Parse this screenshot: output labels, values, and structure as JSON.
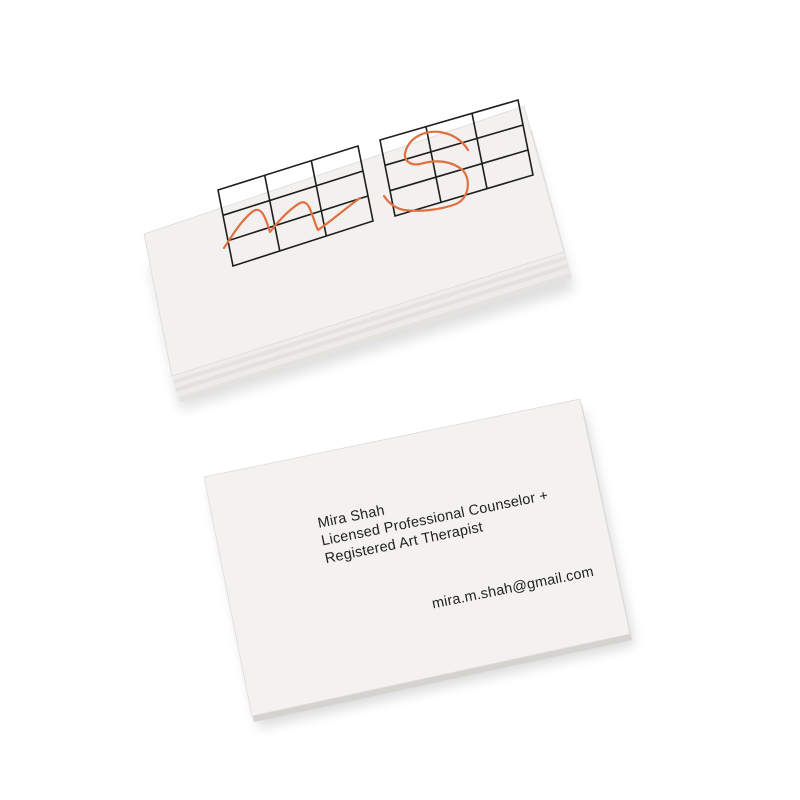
{
  "front_card": {
    "name": "Mira Shah",
    "title_line1": "Licensed Professional Counselor +",
    "title_line2": "Registered Art Therapist",
    "email": "mira.m.shah@gmail.com"
  },
  "back_card": {
    "logo": {
      "letters": "MS",
      "grid": "3x3 grid per letter, two grids",
      "stroke_color": "#e0703f",
      "grid_color": "#1e1e1e"
    }
  },
  "colors": {
    "background": "#ffffff",
    "card": "#f1f0ee",
    "card_edge": "#d9d8d5",
    "text": "#1f1f1f",
    "accent_orange": "#e0703f"
  }
}
